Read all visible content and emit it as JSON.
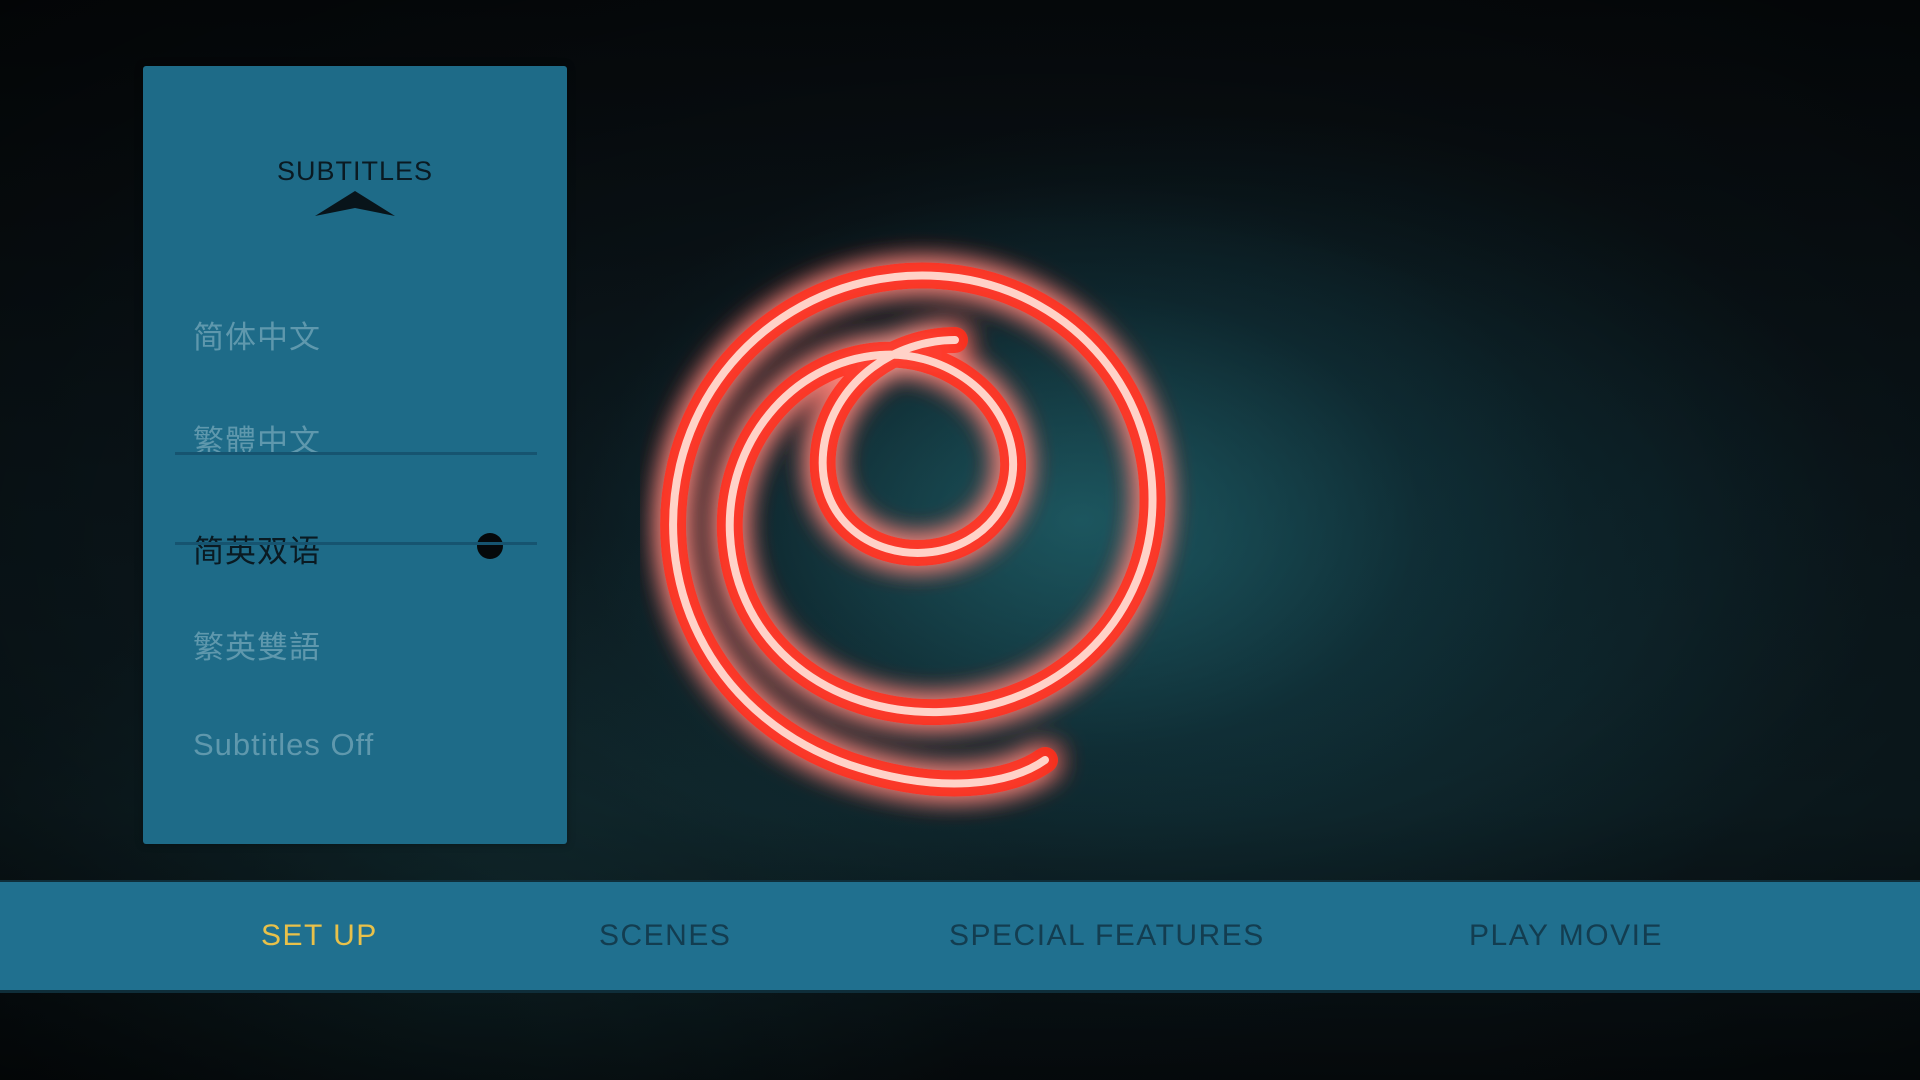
{
  "subtitles_menu": {
    "title": "SUBTITLES",
    "options": [
      {
        "label": "简体中文",
        "selected": false
      },
      {
        "label": "繁體中文",
        "selected": false
      },
      {
        "label": "简英双语",
        "selected": true
      },
      {
        "label": "繁英雙語",
        "selected": false
      },
      {
        "label": "Subtitles Off",
        "selected": false
      }
    ]
  },
  "nav": {
    "items": [
      {
        "label": "SET UP",
        "active": true
      },
      {
        "label": "SCENES",
        "active": false
      },
      {
        "label": "SPECIAL FEATURES",
        "active": false
      },
      {
        "label": "PLAY MOVIE",
        "active": false
      }
    ]
  },
  "colors": {
    "panel": "#1e6b88",
    "navbar": "#20708f",
    "active_nav": "#e8c14a",
    "logo_glow": "#e8311f"
  },
  "icons": {
    "scroll_up": "triangle-up-icon",
    "selected_marker": "dot-icon",
    "logo": "spiral-logo"
  }
}
